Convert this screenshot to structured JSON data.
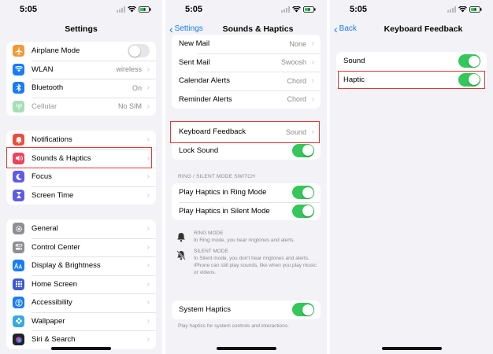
{
  "status_time": "5:05",
  "settings_panel": {
    "title": "Settings",
    "group1": [
      {
        "label": "Airplane Mode",
        "icon": "airplane-icon",
        "color": "#f09a37",
        "toggle": false
      },
      {
        "label": "WLAN",
        "value": "wireless",
        "icon": "wifi-icon",
        "color": "#1a7cf6"
      },
      {
        "label": "Bluetooth",
        "value": "On",
        "icon": "bluetooth-icon",
        "color": "#1a7cf6"
      },
      {
        "label": "Cellular",
        "value": "No SIM",
        "icon": "antenna-icon",
        "color": "#34c759"
      }
    ],
    "group2": [
      {
        "label": "Notifications",
        "icon": "bell-badge-icon",
        "color": "#eb4d3d"
      },
      {
        "label": "Sounds & Haptics",
        "icon": "speaker-icon",
        "color": "#eb445a"
      },
      {
        "label": "Focus",
        "icon": "moon-icon",
        "color": "#5e5ce6"
      },
      {
        "label": "Screen Time",
        "icon": "hourglass-icon",
        "color": "#5e5ce6"
      }
    ],
    "group3": [
      {
        "label": "General",
        "icon": "gear-icon",
        "color": "#8e8e93"
      },
      {
        "label": "Control Center",
        "icon": "switches-icon",
        "color": "#8e8e93"
      },
      {
        "label": "Display & Brightness",
        "icon": "aa-icon",
        "color": "#1a7cf6"
      },
      {
        "label": "Home Screen",
        "icon": "grid-icon",
        "color": "#3c5ad6"
      },
      {
        "label": "Accessibility",
        "icon": "accessibility-icon",
        "color": "#1a7cf6"
      },
      {
        "label": "Wallpaper",
        "icon": "flower-icon",
        "color": "#36aadc"
      },
      {
        "label": "Siri & Search",
        "icon": "siri-icon",
        "color": "#222222"
      }
    ]
  },
  "sounds_panel": {
    "back_label": "Settings",
    "title": "Sounds & Haptics",
    "alerts": [
      {
        "label": "New Mail",
        "value": "None"
      },
      {
        "label": "Sent Mail",
        "value": "Swoosh"
      },
      {
        "label": "Calendar Alerts",
        "value": "Chord"
      },
      {
        "label": "Reminder Alerts",
        "value": "Chord"
      }
    ],
    "keyboard_feedback": {
      "label": "Keyboard Feedback",
      "value": "Sound"
    },
    "lock_sound": {
      "label": "Lock Sound",
      "toggle": true
    },
    "ring_section_header": "RING / SILENT MODE SWITCH",
    "ring_haptics": [
      {
        "label": "Play Haptics in Ring Mode",
        "toggle": true
      },
      {
        "label": "Play Haptics in Silent Mode",
        "toggle": true
      }
    ],
    "ring_mode": {
      "title": "RING MODE",
      "desc": "In Ring mode, you hear ringtones and alerts."
    },
    "silent_mode": {
      "title": "SILENT MODE",
      "desc": "In Silent mode, you don't hear ringtones and alerts. iPhone can still play sounds, like when you play music or videos."
    },
    "system_haptics": {
      "label": "System Haptics",
      "toggle": true
    },
    "system_haptics_note": "Play haptics for system controls and interactions."
  },
  "keyboard_panel": {
    "back_label": "Back",
    "title": "Keyboard Feedback",
    "rows": [
      {
        "label": "Sound",
        "toggle": true
      },
      {
        "label": "Haptic",
        "toggle": true
      }
    ]
  },
  "colors": {
    "accent": "#1a7cf6",
    "toggle_on": "#34c759",
    "highlight": "#e53935"
  }
}
